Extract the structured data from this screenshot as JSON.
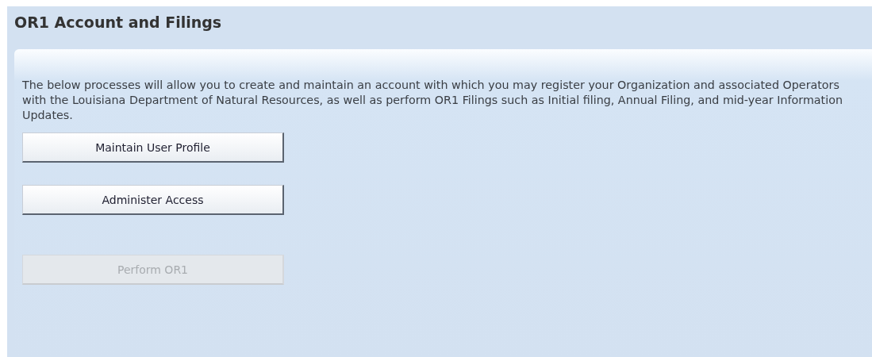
{
  "header": {
    "title": "OR1 Account and Filings"
  },
  "description": "The below processes will allow you to create and maintain an account with which you may register your Organization and associated Operators with the Louisiana Department of Natural Resources, as well as perform OR1 Filings such as Initial filing, Annual Filing, and mid-year Information Updates.",
  "buttons": [
    {
      "label": "Maintain User Profile",
      "disabled": false
    },
    {
      "label": "Administer Access",
      "disabled": false
    },
    {
      "label": "Perform OR1",
      "disabled": true
    }
  ]
}
